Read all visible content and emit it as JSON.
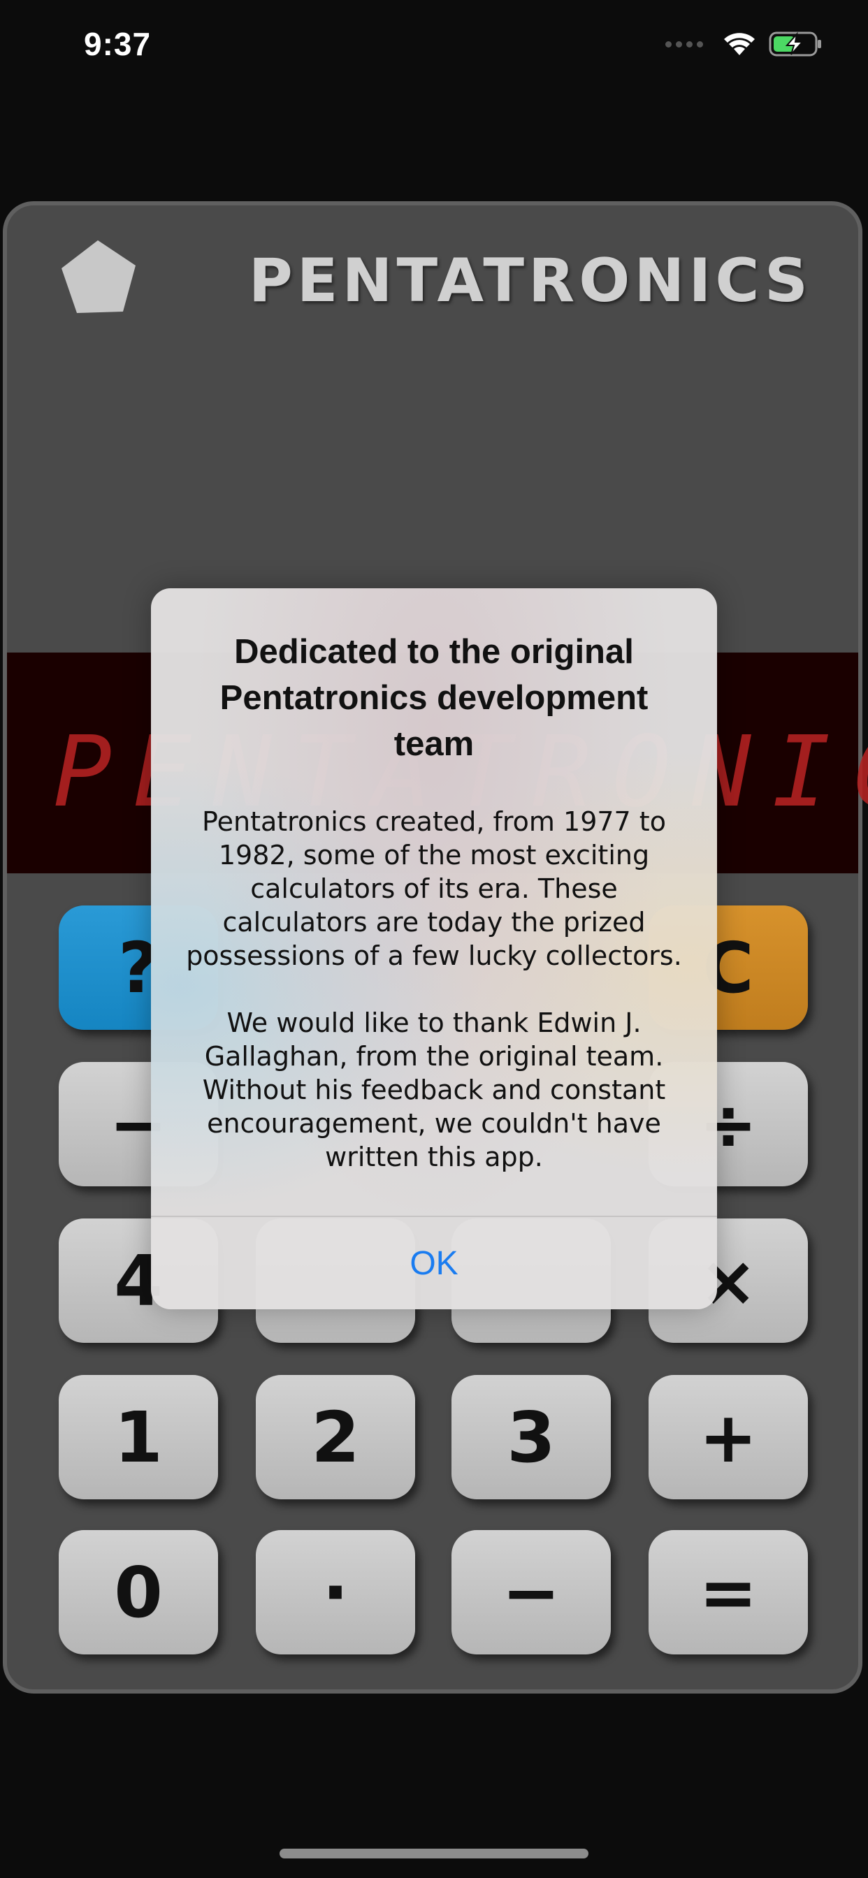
{
  "status_bar": {
    "time": "9:37",
    "icons": [
      "signal-icon",
      "wifi-icon",
      "battery-charging-icon"
    ]
  },
  "calculator": {
    "brand": "PENTATRONICS",
    "display": "PENTATRONICS",
    "keys": [
      {
        "label": "?",
        "color": "#1a8fcc"
      },
      {
        "label": "C",
        "color": "#c9861f"
      },
      {
        "label": "−"
      },
      {
        "label": "÷"
      },
      {
        "label": "4"
      },
      {
        "label": "×"
      },
      {
        "label": "1"
      },
      {
        "label": "2"
      },
      {
        "label": "3"
      },
      {
        "label": "+"
      },
      {
        "label": "0"
      },
      {
        "label": "·"
      },
      {
        "label": "−"
      },
      {
        "label": "="
      }
    ]
  },
  "alert": {
    "title": "Dedicated to the original Pentatronics development team",
    "message_paragraphs": [
      "Pentatronics created, from 1977 to 1982, some of the most exciting calculators of its era. These calculators are today the prized possessions of a few lucky collectors.",
      "We would like to thank Edwin J. Gallaghan, from the original team. Without his feedback and constant encouragement, we couldn't have written this app."
    ],
    "ok_label": "OK",
    "accent_color": "#1a7cf0"
  }
}
